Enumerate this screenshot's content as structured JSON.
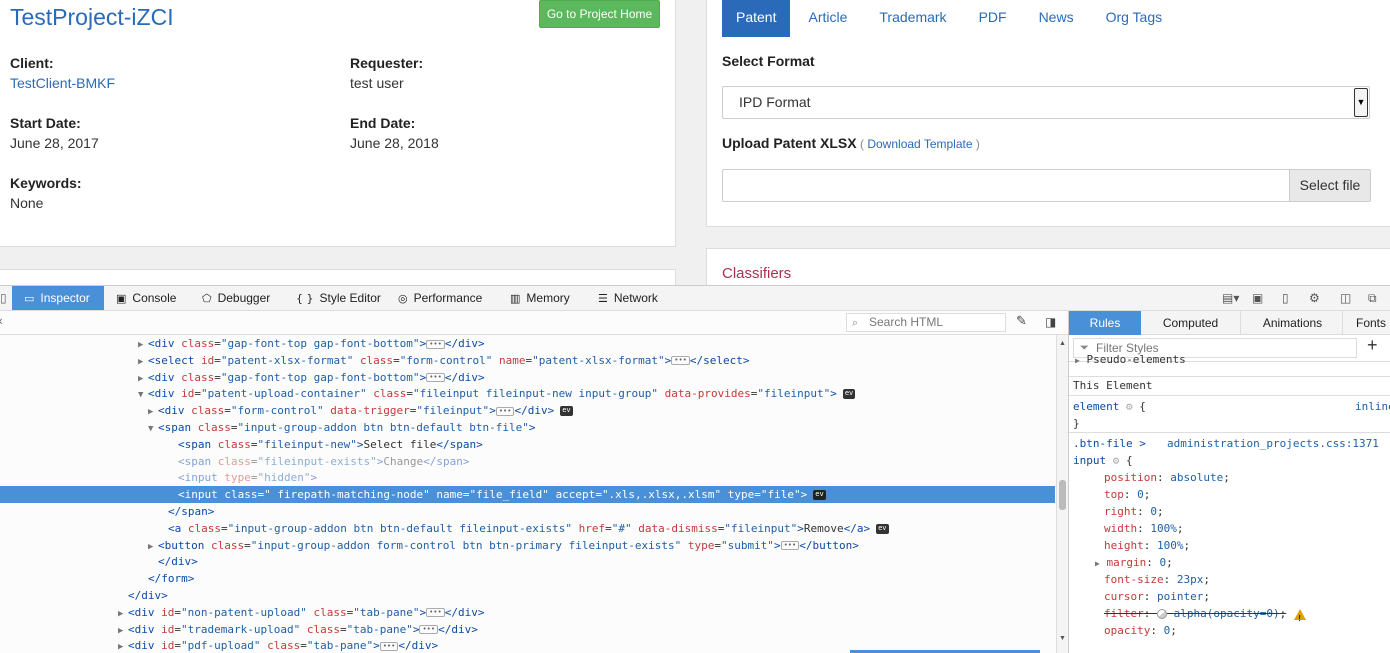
{
  "page": {
    "project_title": "TestProject-iZCI",
    "go_home_label": "Go to Project Home",
    "client_label": "Client:",
    "client_value": "TestClient-BMKF",
    "requester_label": "Requester:",
    "requester_value": "test user",
    "start_label": "Start Date:",
    "start_value": "June 28, 2017",
    "end_label": "End Date:",
    "end_value": "June 28, 2018",
    "keywords_label": "Keywords:",
    "keywords_value": "None",
    "tabs": [
      "Patent",
      "Article",
      "Trademark",
      "PDF",
      "News",
      "Org Tags"
    ],
    "active_tab": "Patent",
    "select_format_label": "Select Format",
    "select_format_value": "IPD Format",
    "upload_label": "Upload Patent XLSX",
    "download_template": "Download Template",
    "select_file_label": "Select file",
    "classifiers_label": "Classifiers"
  },
  "devtools": {
    "tabs": [
      "Inspector",
      "Console",
      "Debugger",
      "Style Editor",
      "Performance",
      "Memory",
      "Network"
    ],
    "active_tab": "Inspector",
    "search_placeholder": "Search HTML",
    "markup_lines": [
      {
        "depth": 14,
        "twisty": "▶",
        "html": "<div class=\"gap-font-top gap-font-bottom\">…</div>"
      },
      {
        "depth": 14,
        "twisty": "▶",
        "html": "<select id=\"patent-xlsx-format\" class=\"form-control\" name=\"patent-xlsx-format\">…</select>"
      },
      {
        "depth": 14,
        "twisty": "▶",
        "html": "<div class=\"gap-font-top gap-font-bottom\">…</div>"
      },
      {
        "depth": 14,
        "twisty": "▼",
        "html": "<div id=\"patent-upload-container\" class=\"fileinput fileinput-new input-group\" data-provides=\"fileinput\"> ev"
      },
      {
        "depth": 15,
        "twisty": "▶",
        "html": "<div class=\"form-control\" data-trigger=\"fileinput\">…</div> ev"
      },
      {
        "depth": 15,
        "twisty": "▼",
        "html": "<span class=\"input-group-addon btn btn-default btn-file\">"
      },
      {
        "depth": 17,
        "twisty": "",
        "html": "<span class=\"fileinput-new\">Select file</span>"
      },
      {
        "depth": 17,
        "twisty": "",
        "html": "<span class=\"fileinput-exists\">Change</span>",
        "dim": true
      },
      {
        "depth": 17,
        "twisty": "",
        "html": "<input type=\"hidden\">",
        "dim": true
      },
      {
        "depth": 17,
        "twisty": "",
        "html": "<input class=\" firepath-matching-node\" name=\"file_field\" accept=\".xls,.xlsx,.xlsm\" type=\"file\"> ev",
        "selected": true
      },
      {
        "depth": 16,
        "twisty": "",
        "html": "</span>"
      },
      {
        "depth": 16,
        "twisty": "",
        "html": "<a class=\"input-group-addon btn btn-default fileinput-exists\" href=\"#\" data-dismiss=\"fileinput\">Remove</a> ev"
      },
      {
        "depth": 15,
        "twisty": "▶",
        "html": "<button class=\"input-group-addon form-control btn btn-primary fileinput-exists\" type=\"submit\">…</button>"
      },
      {
        "depth": 15,
        "twisty": "",
        "html": "</div>"
      },
      {
        "depth": 14,
        "twisty": "",
        "html": "</form>"
      },
      {
        "depth": 12,
        "twisty": "",
        "html": "</div>"
      },
      {
        "depth": 12,
        "twisty": "▶",
        "html": "<div id=\"non-patent-upload\" class=\"tab-pane\">…</div>"
      },
      {
        "depth": 12,
        "twisty": "▶",
        "html": "<div id=\"trademark-upload\" class=\"tab-pane\">…</div>"
      },
      {
        "depth": 12,
        "twisty": "▶",
        "html": "<div id=\"pdf-upload\" class=\"tab-pane\">…</div>"
      }
    ],
    "sidebar_tabs": [
      "Rules",
      "Computed",
      "Animations",
      "Fonts"
    ],
    "sidebar_active": "Rules",
    "filter_placeholder": "Filter Styles",
    "pseudo_elements": "Pseudo-elements",
    "this_element": "This Element",
    "element_rule": "element",
    "element_inline": "inline",
    "rule_selector_1": ".btn-file >",
    "rule_selector_2": "input",
    "rule_source": "administration_projects.css:1371",
    "declarations": [
      {
        "name": "position",
        "value": "absolute"
      },
      {
        "name": "top",
        "value": "0"
      },
      {
        "name": "right",
        "value": "0"
      },
      {
        "name": "width",
        "value": "100%"
      },
      {
        "name": "height",
        "value": "100%"
      },
      {
        "name": "margin",
        "value": "0",
        "expandable": true
      },
      {
        "name": "font-size",
        "value": "23px"
      },
      {
        "name": "cursor",
        "value": "pointer"
      },
      {
        "name": "filter",
        "value": "alpha(opacity=0)",
        "overridden": true
      },
      {
        "name": "opacity",
        "value": "0"
      }
    ]
  },
  "colors": {
    "accent": "#2a6ab8",
    "green": "#5cb85c",
    "devtools_selection": "#4a90d9",
    "classifiers": "#a8324f"
  }
}
